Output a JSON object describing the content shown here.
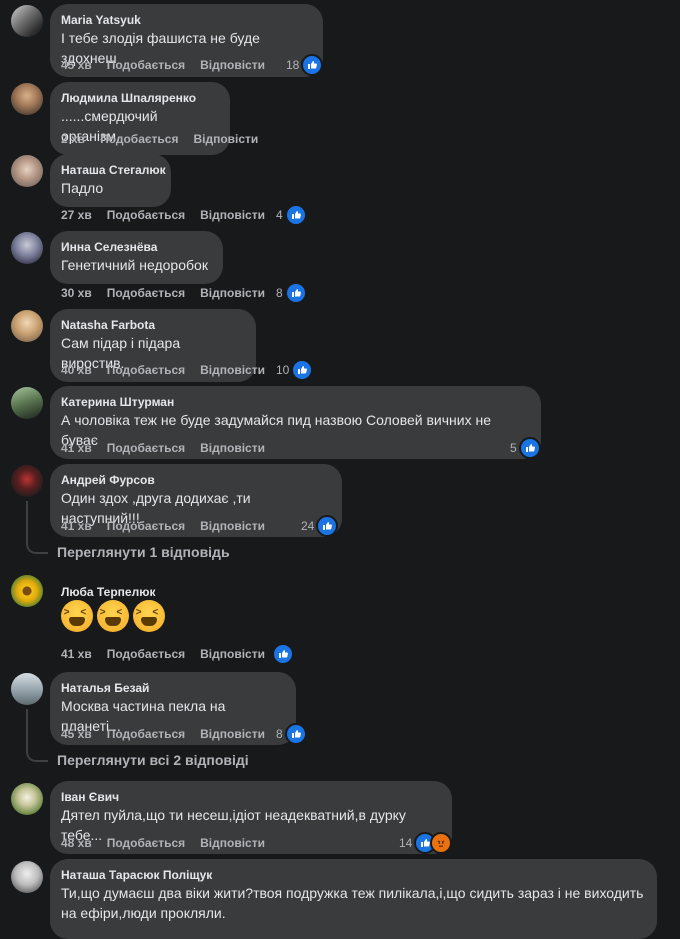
{
  "actions": {
    "like": "Подобається",
    "reply": "Відповісти"
  },
  "comments": [
    {
      "author": "Maria Yatsyuk",
      "text": "І тебе злодія фашиста не буде здохнеш",
      "time": "45 хв",
      "reactions": "18",
      "reaction_icons": [
        "like-icon"
      ]
    },
    {
      "author": "Людмила Шпаляренко",
      "text": "......смердючий організм.",
      "time": "2 хв",
      "reactions": "",
      "reaction_icons": []
    },
    {
      "author": "Наташа Стегалюк",
      "text": "Падло",
      "time": "27 хв",
      "reactions": "4",
      "reaction_icons": [
        "like-icon"
      ]
    },
    {
      "author": "Инна Селезнёва",
      "text": "Генетичний недоробок",
      "time": "30 хв",
      "reactions": "8",
      "reaction_icons": [
        "like-icon"
      ]
    },
    {
      "author": "Natasha Farbota",
      "text": "Сам підар і підара виростив.",
      "time": "40 хв",
      "reactions": "10",
      "reaction_icons": [
        "like-icon"
      ]
    },
    {
      "author": "Катерина Штурман",
      "text": "А чоловіка теж не буде задумайся пид назвою Соловей вичних не буває",
      "time": "41 хв",
      "reactions": "5",
      "reaction_icons": [
        "like-icon"
      ]
    },
    {
      "author": "Андрей Фурсов",
      "text": "Один здох ,друга додихає ,ти наступний!!!",
      "time": "41 хв",
      "reactions": "24",
      "reaction_icons": [
        "like-icon"
      ],
      "replies_link": "Переглянути 1 відповідь"
    },
    {
      "author": "Люба Терпелюк",
      "text": "",
      "time": "41 хв",
      "reactions": "",
      "reaction_icons": [
        "like-icon"
      ],
      "emoji_count": 3
    },
    {
      "author": "Наталья Безай",
      "text": "Москва частина пекла на планеті...",
      "time": "45 хв",
      "reactions": "8",
      "reaction_icons": [
        "like-icon"
      ],
      "replies_link": "Переглянути всі 2 відповіді"
    },
    {
      "author": "Іван Євич",
      "text": "Дятел пуйла,що ти несеш,ідіот неадекватний,в дурку тебе...",
      "time": "48 хв",
      "reactions": "14",
      "reaction_icons": [
        "like-icon",
        "angry-icon"
      ]
    },
    {
      "author": "Наташа Тарасюк Поліщук",
      "text": "Ти,що думаєш два віки жити?твоя подружка теж пилікала,і,що сидить зараз і не виходить на ефіри,люди прокляли.",
      "time": "",
      "reactions": "",
      "reaction_icons": []
    }
  ],
  "colors": {
    "background": "#18191a",
    "bubble": "#3a3b3c",
    "text": "#e4e6eb",
    "secondary": "#b0b3b8",
    "like_blue": "#1b74e4"
  }
}
